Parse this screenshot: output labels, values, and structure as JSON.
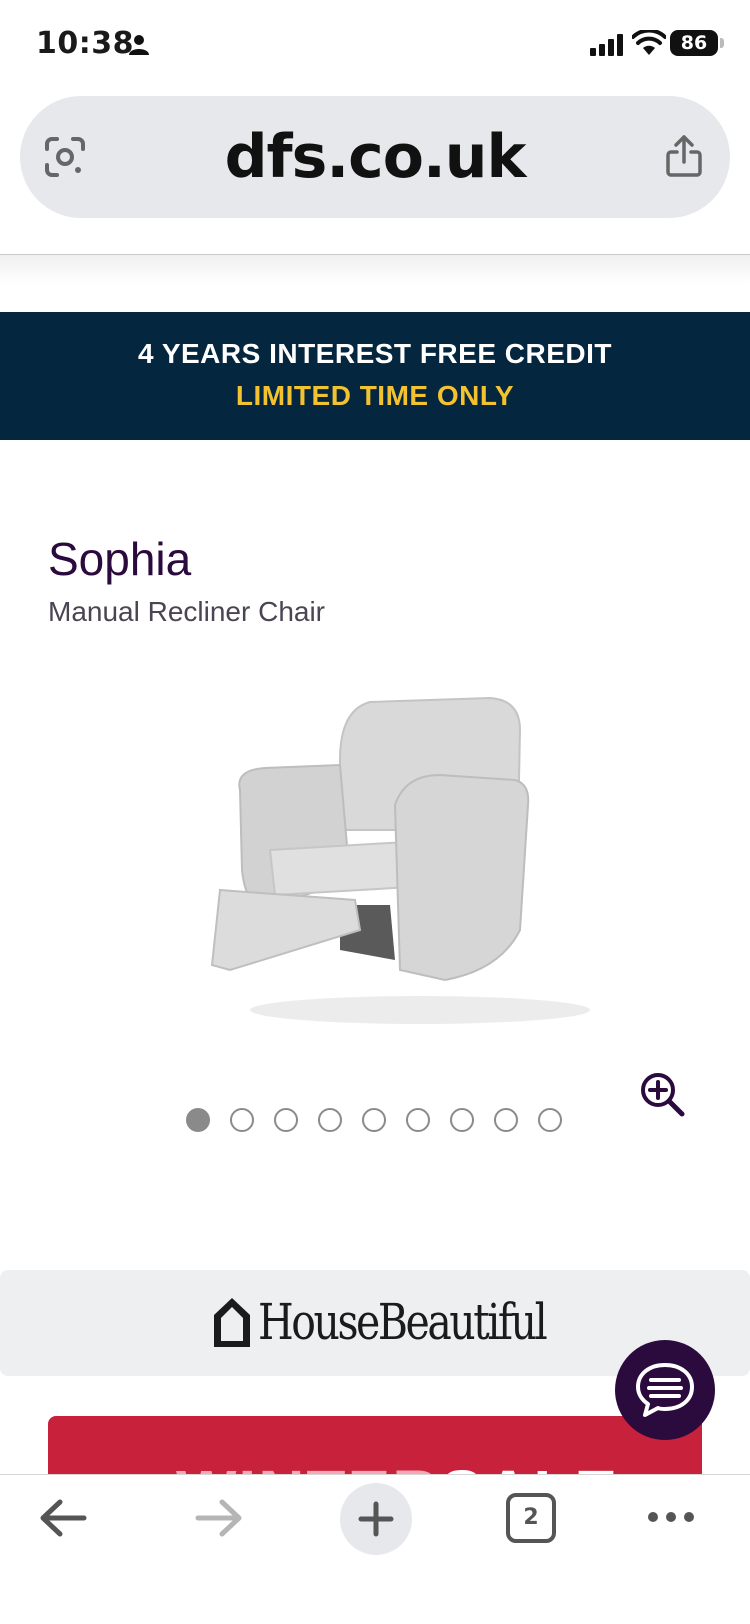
{
  "status_bar": {
    "time": "10:38",
    "battery": "86"
  },
  "browser": {
    "url": "dfs.co.uk",
    "tab_count": "2"
  },
  "promo": {
    "line1": "4 YEARS INTEREST FREE CREDIT",
    "line2": "LIMITED TIME ONLY"
  },
  "product": {
    "name": "Sophia",
    "type": "Manual Recliner Chair"
  },
  "carousel": {
    "total_images": 9,
    "active_index": 0
  },
  "partner": {
    "logo_text": "HouseBeautiful"
  },
  "sale_banner": {
    "text_part1": "WINTER",
    "text_part2": "SALE"
  },
  "colors": {
    "promo_bg": "#04263f",
    "promo_accent": "#f2c230",
    "brand_purple": "#2b0a3d",
    "sale_red": "#c8213c"
  },
  "icons": [
    "person-icon",
    "signal-icon",
    "wifi-icon",
    "lens-icon",
    "share-icon",
    "zoom-icon",
    "chat-icon",
    "back-icon",
    "forward-icon",
    "plus-icon",
    "more-icon"
  ]
}
